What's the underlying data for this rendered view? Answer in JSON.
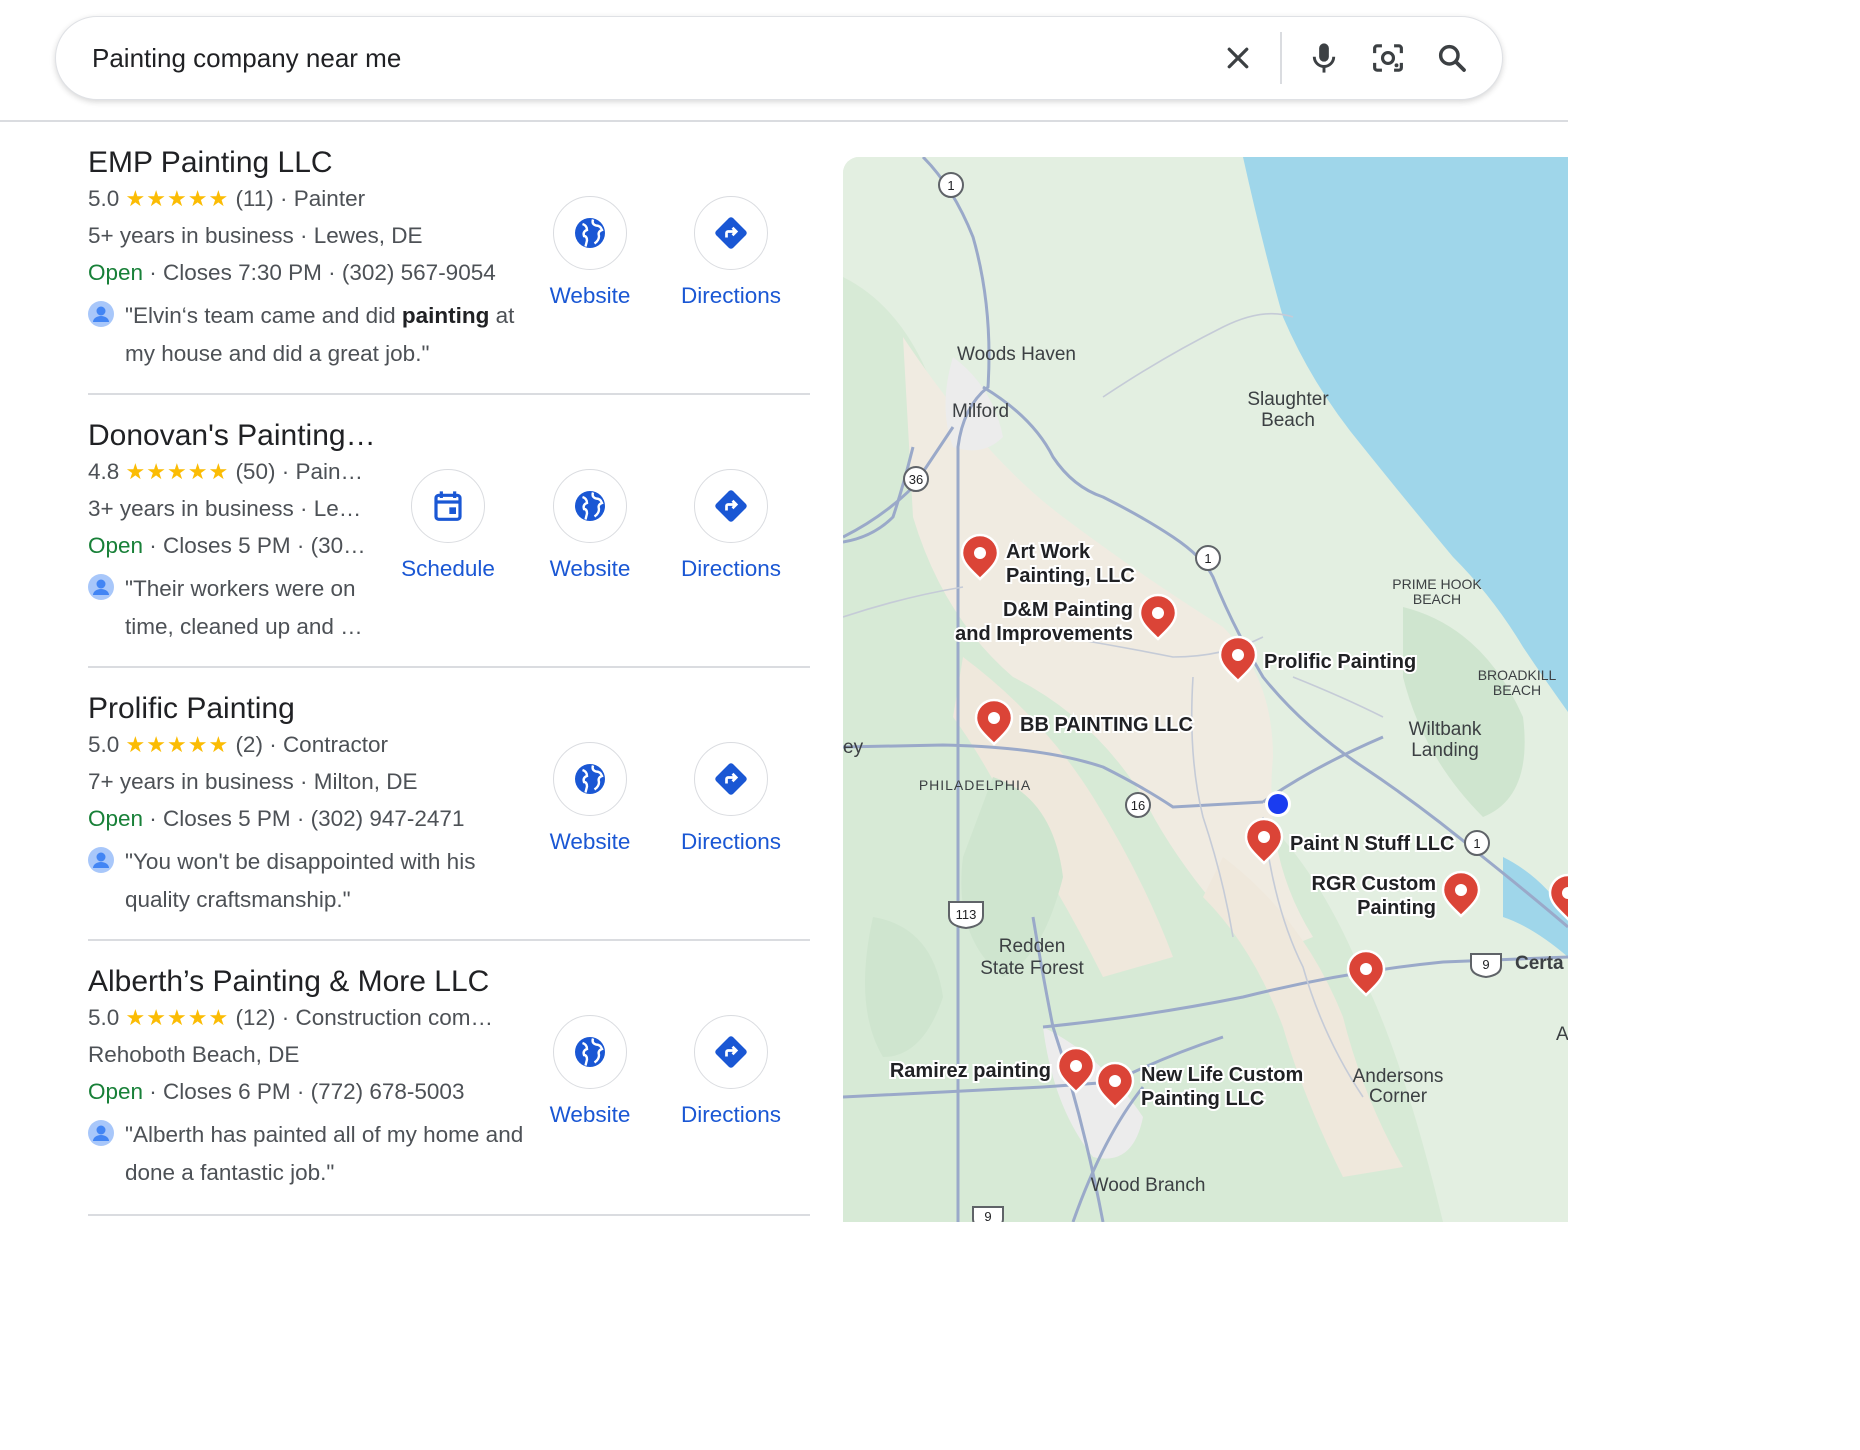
{
  "search": {
    "query": "Painting company near me",
    "clear_icon": "close-icon",
    "voice_icon": "mic-icon",
    "lens_icon": "lens-icon",
    "search_icon": "search-icon"
  },
  "results": [
    {
      "name": "EMP Painting LLC",
      "rating": "5.0",
      "stars": "★★★★★",
      "reviews": "(11)",
      "category": "Painter",
      "years": "5+ years in business",
      "location": "Lewes, DE",
      "status": "Open",
      "closes": "Closes 7:30 PM",
      "phone": "(302) 567-9054",
      "review_pre": "\"Elvin‘s team came and did ",
      "review_bold": "painting",
      "review_post": " at my house and did a great job.\"",
      "actions": [
        "Website",
        "Directions"
      ]
    },
    {
      "name": "Donovan's Painting…",
      "rating": "4.8",
      "stars": "★★★★★",
      "reviews": "(50)",
      "category": "Pain…",
      "years": "3+ years in business",
      "location": "Le…",
      "status": "Open",
      "closes": "Closes 5 PM",
      "phone": "(30…",
      "review_pre": "\"Their workers were on time, cleaned up and …",
      "review_bold": "",
      "review_post": "",
      "actions": [
        "Schedule",
        "Website",
        "Directions"
      ]
    },
    {
      "name": "Prolific Painting",
      "rating": "5.0",
      "stars": "★★★★★",
      "reviews": "(2)",
      "category": "Contractor",
      "years": "7+ years in business",
      "location": "Milton, DE",
      "status": "Open",
      "closes": "Closes 5 PM",
      "phone": "(302) 947-2471",
      "review_pre": "\"You won't be disappointed with his quality craftsmanship.\"",
      "review_bold": "",
      "review_post": "",
      "actions": [
        "Website",
        "Directions"
      ]
    },
    {
      "name": "Alberth’s Painting & More LLC",
      "rating": "5.0",
      "stars": "★★★★★",
      "reviews": "(12)",
      "category": "Construction com…",
      "years": "",
      "location": "Rehoboth Beach, DE",
      "status": "Open",
      "closes": "Closes 6 PM",
      "phone": "(772) 678-5003",
      "review_pre": "\"Alberth has painted all of my home and done a fantastic job.\"",
      "review_bold": "",
      "review_post": "",
      "actions": [
        "Website",
        "Directions"
      ]
    }
  ],
  "map": {
    "places": [
      "Woods Haven",
      "Milford",
      "Slaughter",
      "Beach",
      "PRIME HOOK",
      "BEACH",
      "BROADKILL",
      "BEACH",
      "Wiltbank",
      "Landing",
      "PHILADELPHIA",
      "Redden",
      "State Forest",
      "Andersons",
      "Corner",
      "Wood Branch",
      "ey",
      "Certa",
      "A"
    ],
    "pins": [
      "Art Work",
      "Painting, LLC",
      "D&M Painting",
      "and Improvements",
      "Prolific Painting",
      "BB PAINTING LLC",
      "Paint N Stuff LLC",
      "RGR Custom",
      "Painting",
      "Ramirez painting",
      "New Life Custom",
      "Painting LLC"
    ],
    "shields": [
      "1",
      "36",
      "1",
      "16",
      "1",
      "113",
      "9",
      "9"
    ]
  },
  "colors": {
    "link": "#1a57d4",
    "open": "#188038",
    "star": "#fbbc04",
    "pin": "#db4437",
    "water": "#9fd6ea",
    "land": "#e3efe1"
  }
}
